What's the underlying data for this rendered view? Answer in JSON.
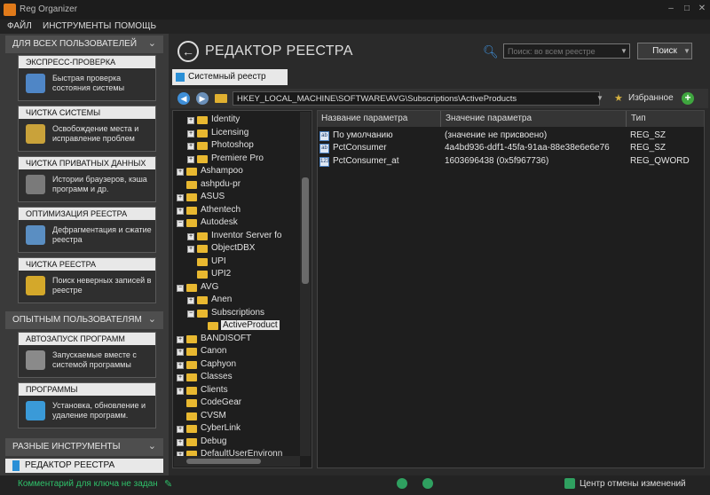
{
  "window": {
    "title": "Reg Organizer",
    "min": "–",
    "max": "□",
    "close": "✕"
  },
  "menu": [
    "ФАЙЛ",
    "ИНСТРУМЕНТЫ",
    "ПОМОЩЬ"
  ],
  "sidebar": {
    "sections": [
      {
        "title": "ДЛЯ ВСЕХ ПОЛЬЗОВАТЕЛЕЙ"
      },
      {
        "title": "ОПЫТНЫМ ПОЛЬЗОВАТЕЛЯМ"
      },
      {
        "title": "РАЗНЫЕ ИНСТРУМЕНТЫ"
      }
    ],
    "cards": [
      {
        "title": "ЭКСПРЕСС-ПРОВЕРКА",
        "desc": "Быстрая проверка состояния системы",
        "icon": "check-shield-icon"
      },
      {
        "title": "ЧИСТКА СИСТЕМЫ",
        "desc": "Освобождение места и исправление проблем",
        "icon": "cleanup-icon"
      },
      {
        "title": "ЧИСТКА ПРИВАТНЫХ ДАННЫХ",
        "desc": "Истории браузеров, кэша программ и др.",
        "icon": "privacy-icon"
      },
      {
        "title": "ОПТИМИЗАЦИЯ РЕЕСТРА",
        "desc": "Дефрагментация и сжатие реестра",
        "icon": "defrag-icon"
      },
      {
        "title": "ЧИСТКА РЕЕСТРА",
        "desc": "Поиск неверных записей в реестре",
        "icon": "registry-clean-icon"
      },
      {
        "title": "АВТОЗАПУСК ПРОГРАММ",
        "desc": "Запускаемые вместе с системой программы",
        "icon": "autorun-icon"
      },
      {
        "title": "ПРОГРАММЫ",
        "desc": "Установка, обновление и удаление программ.",
        "icon": "programs-icon"
      }
    ],
    "active_item": "РЕДАКТОР РЕЕСТРА"
  },
  "header": {
    "title": "РЕДАКТОР РЕЕСТРА",
    "search_placeholder": "Поиск: во всем реестре",
    "find_label": "Поиск"
  },
  "tab": {
    "label": "Системный реестр"
  },
  "toolbar": {
    "path": "HKEY_LOCAL_MACHINE\\SOFTWARE\\AVG\\Subscriptions\\ActiveProducts",
    "favorites_label": "Избранное"
  },
  "tree": [
    {
      "label": "Identity",
      "exp": "+"
    },
    {
      "label": "Licensing",
      "exp": "+"
    },
    {
      "label": "Photoshop",
      "exp": "+"
    },
    {
      "label": "Premiere Pro",
      "exp": "+"
    },
    {
      "label": "Ashampoo",
      "exp": "+"
    },
    {
      "label": "ashpdu-pr",
      "exp": ""
    },
    {
      "label": "ASUS",
      "exp": "+"
    },
    {
      "label": "Athentech",
      "exp": "+"
    },
    {
      "label": "Autodesk",
      "exp": "−"
    },
    {
      "label": "Inventor Server fo",
      "exp": "+"
    },
    {
      "label": "ObjectDBX",
      "exp": "+"
    },
    {
      "label": "UPI",
      "exp": ""
    },
    {
      "label": "UPI2",
      "exp": ""
    },
    {
      "label": "AVG",
      "exp": "−"
    },
    {
      "label": "Anen",
      "exp": "+"
    },
    {
      "label": "Subscriptions",
      "exp": "−"
    },
    {
      "label": "ActiveProduct",
      "exp": ""
    },
    {
      "label": "BANDISOFT",
      "exp": "+"
    },
    {
      "label": "Canon",
      "exp": "+"
    },
    {
      "label": "Caphyon",
      "exp": "+"
    },
    {
      "label": "Classes",
      "exp": "+"
    },
    {
      "label": "Clients",
      "exp": "+"
    },
    {
      "label": "CodeGear",
      "exp": ""
    },
    {
      "label": "CVSM",
      "exp": ""
    },
    {
      "label": "CyberLink",
      "exp": "+"
    },
    {
      "label": "Debug",
      "exp": "+"
    },
    {
      "label": "DefaultUserEnvironn",
      "exp": "+"
    }
  ],
  "table": {
    "columns": [
      "Название параметра",
      "Значение параметра",
      "Тип"
    ],
    "rows": [
      {
        "icon": "ab",
        "name": "По умолчанию",
        "value": "(значение не присвоено)",
        "type": "REG_SZ"
      },
      {
        "icon": "ab",
        "name": "PctConsumer",
        "value": "4a4bd936-ddf1-45fa-91aa-88e38e6e6e76",
        "type": "REG_SZ"
      },
      {
        "icon": "123",
        "name": "PctConsumer_at",
        "value": "1603696438 (0x5f967736)",
        "type": "REG_QWORD"
      }
    ]
  },
  "status": {
    "comment": "Комментарий для ключа не задан",
    "undo_center": "Центр отмены изменений"
  }
}
